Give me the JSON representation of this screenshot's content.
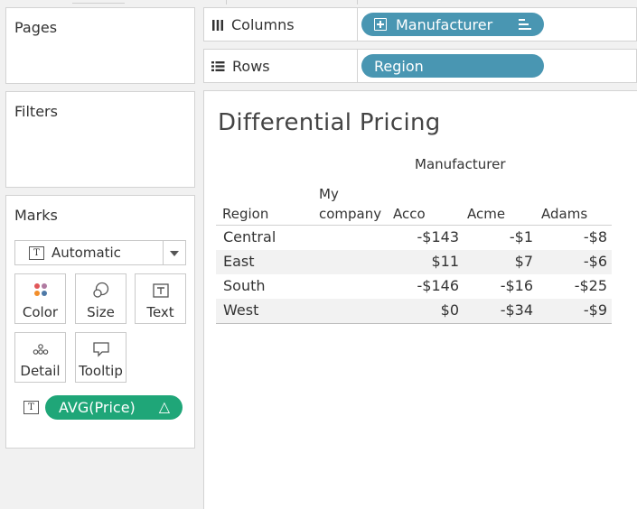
{
  "cards": {
    "pages_title": "Pages",
    "filters_title": "Filters",
    "marks_title": "Marks"
  },
  "shelves": {
    "columns_label": "Columns",
    "rows_label": "Rows",
    "columns_pill": "Manufacturer",
    "rows_pill": "Region"
  },
  "marks": {
    "type_selected": "Automatic",
    "buttons": {
      "color": "Color",
      "size": "Size",
      "text": "Text",
      "detail": "Detail",
      "tooltip": "Tooltip"
    },
    "field_pill": "AVG(Price)",
    "field_pill_badge": "△",
    "text_glyph": "T"
  },
  "viz": {
    "title": "Differential Pricing",
    "column_group_header": "Manufacturer",
    "row_header": "Region",
    "columns": [
      "My\ncompany",
      "Acco",
      "Acme",
      "Adams"
    ],
    "rows": [
      {
        "region": "Central",
        "values": [
          "",
          "-$143",
          "-$1",
          "-$8"
        ]
      },
      {
        "region": "East",
        "values": [
          "",
          "$11",
          "$7",
          "-$6"
        ]
      },
      {
        "region": "South",
        "values": [
          "",
          "-$146",
          "-$16",
          "-$25"
        ]
      },
      {
        "region": "West",
        "values": [
          "",
          "$0",
          "-$34",
          "-$9"
        ]
      }
    ]
  },
  "colors": {
    "shelf_pill": "#4996b2",
    "measure_pill": "#1fa678"
  }
}
